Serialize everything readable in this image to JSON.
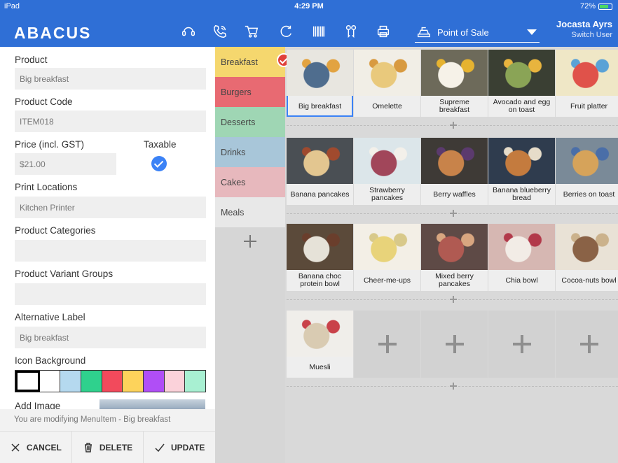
{
  "status_bar": {
    "device": "iPad",
    "time": "4:29 PM",
    "battery": "72%",
    "battery_level": 0.72
  },
  "header": {
    "brand": "ABACUS",
    "icons": [
      "headset-icon",
      "phone-icon",
      "cart-icon",
      "refresh-icon",
      "barcode-icon",
      "keys-icon",
      "printer-icon"
    ],
    "mode_select": {
      "value": "Point of Sale"
    },
    "user": {
      "name": "Jocasta Ayrs",
      "switch_label": "Switch User"
    }
  },
  "form": {
    "product_label": "Product",
    "product_value": "Big breakfast",
    "code_label": "Product Code",
    "code_value": "ITEM018",
    "price_label": "Price (incl. GST)",
    "price_value": "$21.00",
    "taxable_label": "Taxable",
    "taxable": true,
    "print_label": "Print Locations",
    "print_value": "Kitchen Printer",
    "categories_label": "Product Categories",
    "categories_value": "",
    "variants_label": "Product Variant Groups",
    "variants_value": "",
    "alt_label": "Alternative Label",
    "alt_value": "Big breakfast",
    "icon_bg_label": "Icon Background",
    "swatches": [
      "#ffffff",
      "#ffffff",
      "#b5d9ef",
      "#2fd18d",
      "#f24a5c",
      "#fdd35b",
      "#b04ef6",
      "#fbd2da",
      "#a8f0d2"
    ],
    "add_image_label": "Add Image"
  },
  "footer": {
    "modifying": "You are modifying MenuItem - Big breakfast",
    "cancel": "CANCEL",
    "delete": "DELETE",
    "update": "UPDATE"
  },
  "categories": [
    {
      "label": "Breakfast",
      "color": "#f5d76e",
      "selected": true
    },
    {
      "label": "Burgers",
      "color": "#e86a72"
    },
    {
      "label": "Desserts",
      "color": "#9fd6b4"
    },
    {
      "label": "Drinks",
      "color": "#a8c6d9"
    },
    {
      "label": "Cakes",
      "color": "#e7b8bd"
    },
    {
      "label": "Meals",
      "color": "#e8e8e8"
    }
  ],
  "menu_rows": [
    [
      {
        "label": "Big breakfast",
        "selected": true,
        "c1": "#e8e6e0",
        "c2": "#4f6d8e",
        "c3": "#e2a341"
      },
      {
        "label": "Omelette",
        "c1": "#f1eee6",
        "c2": "#e9c97c",
        "c3": "#d89a40"
      },
      {
        "label": "Supreme\nbreakfast",
        "c1": "#6d6a5a",
        "c2": "#f6f2e8",
        "c3": "#e6b330"
      },
      {
        "label": "Avocado and egg\non toast",
        "c1": "#3a3f33",
        "c2": "#8aa456",
        "c3": "#e8b43e"
      },
      {
        "label": "Fruit platter",
        "c1": "#efe7c6",
        "c2": "#e0524a",
        "c3": "#5aa2d6"
      }
    ],
    [
      {
        "label": "Banana pancakes",
        "c1": "#4a4f54",
        "c2": "#e3c690",
        "c3": "#a04a2e"
      },
      {
        "label": "Strawberry\npancakes",
        "c1": "#dce6ea",
        "c2": "#a1465a",
        "c3": "#f3f0ea"
      },
      {
        "label": "Berry waffles",
        "c1": "#3e3a36",
        "c2": "#c8834a",
        "c3": "#5b3a6e"
      },
      {
        "label": "Banana blueberry\nbread",
        "c1": "#2f3c4e",
        "c2": "#c47b3e",
        "c3": "#e6dcc9"
      },
      {
        "label": "Berries on toast",
        "c1": "#7a8a98",
        "c2": "#d6a35a",
        "c3": "#4a6ea8"
      }
    ],
    [
      {
        "label": "Banana choc\nprotein bowl",
        "c1": "#5b4a3a",
        "c2": "#e6e2d8",
        "c3": "#6a3e2c"
      },
      {
        "label": "Cheer-me-ups",
        "c1": "#f3efe6",
        "c2": "#e8d37a",
        "c3": "#d8c98a"
      },
      {
        "label": "Mixed berry\npancakes",
        "c1": "#5e4a46",
        "c2": "#b05a52",
        "c3": "#d8a680"
      },
      {
        "label": "Chia bowl",
        "c1": "#d6b7b2",
        "c2": "#f2ece6",
        "c3": "#b2394a"
      },
      {
        "label": "Cocoa-nuts bowl",
        "c1": "#e9e2d6",
        "c2": "#8a6246",
        "c3": "#cbb28c"
      }
    ],
    [
      {
        "label": "Muesli",
        "c1": "#f0eeea",
        "c2": "#d9cbb2",
        "c3": "#c9424a"
      },
      {
        "empty": true
      },
      {
        "empty": true
      },
      {
        "empty": true
      },
      {
        "empty": true
      }
    ]
  ]
}
